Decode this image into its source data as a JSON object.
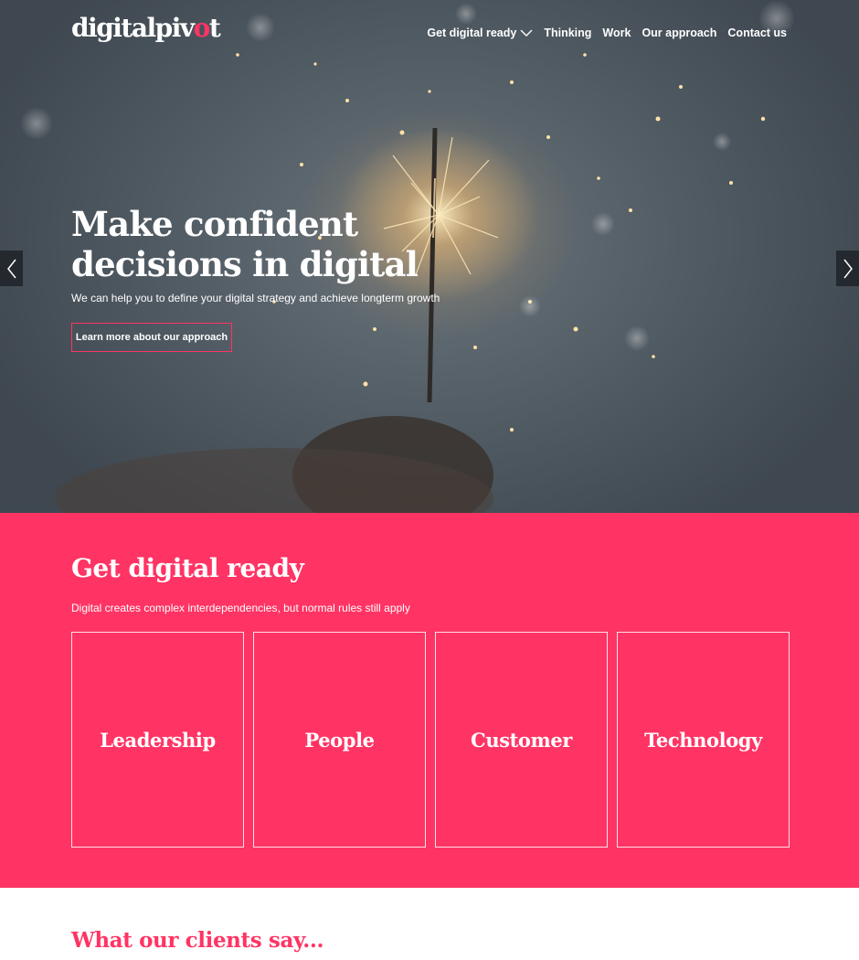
{
  "brand": {
    "name_start": "digitalpiv",
    "name_highlight": "o",
    "name_end": "t",
    "accent_color": "#ff3464"
  },
  "nav": {
    "items": [
      {
        "label": "Get digital ready",
        "icon": "chevron-down-icon"
      },
      {
        "label": "Thinking"
      },
      {
        "label": "Work"
      },
      {
        "label": "Our approach"
      },
      {
        "label": "Contact us"
      }
    ]
  },
  "hero": {
    "title": "Make confident decisions in digital",
    "subtitle": "We can help you to define your digital strategy and achieve longterm growth",
    "cta_label": "Learn more about our approach",
    "prev_icon": "chevron-left-icon",
    "next_icon": "chevron-right-icon"
  },
  "digital_ready": {
    "title": "Get digital ready",
    "subtitle": "Digital creates complex interdependencies, but normal rules still apply",
    "cards": [
      {
        "label": "Leadership"
      },
      {
        "label": "People"
      },
      {
        "label": "Customer"
      },
      {
        "label": "Technology"
      }
    ]
  },
  "testimonials": {
    "title": "What our clients say..."
  }
}
